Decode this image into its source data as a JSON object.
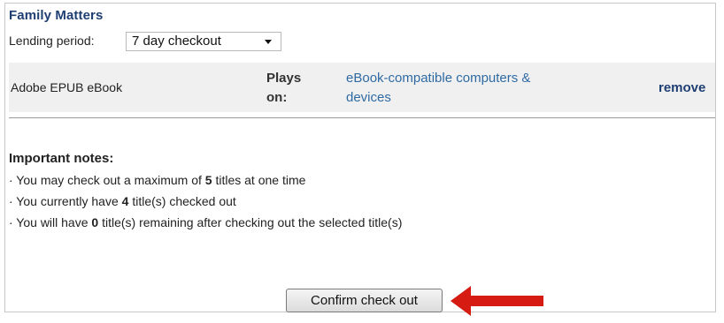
{
  "section_title": "Family Matters",
  "lending": {
    "label": "Lending period:",
    "selected": "7 day checkout"
  },
  "format": {
    "name": "Adobe EPUB eBook",
    "plays_label_1": "Plays",
    "plays_label_2": "on:",
    "devices_line_1": "eBook-compatible computers &",
    "devices_line_2": "devices",
    "remove_label": "remove"
  },
  "notes": {
    "heading": "Important notes:",
    "line1_prefix": "· You may check out a maximum of ",
    "line1_value": "5",
    "line1_suffix": " titles at one time",
    "line2_prefix": "· You currently have ",
    "line2_value": "4",
    "line2_suffix": " title(s) checked out",
    "line3_prefix": "· You will have ",
    "line3_value": "0",
    "line3_suffix": " title(s) remaining after checking out the selected title(s)"
  },
  "confirm_button": "Confirm check out",
  "colors": {
    "title": "#1f3f73",
    "link": "#2f6aa3",
    "arrow": "#d51b12",
    "row_bg": "#f0f0f0"
  },
  "icons": {
    "dropdown": "chevron-down-icon",
    "pointer": "red-arrow-icon"
  }
}
